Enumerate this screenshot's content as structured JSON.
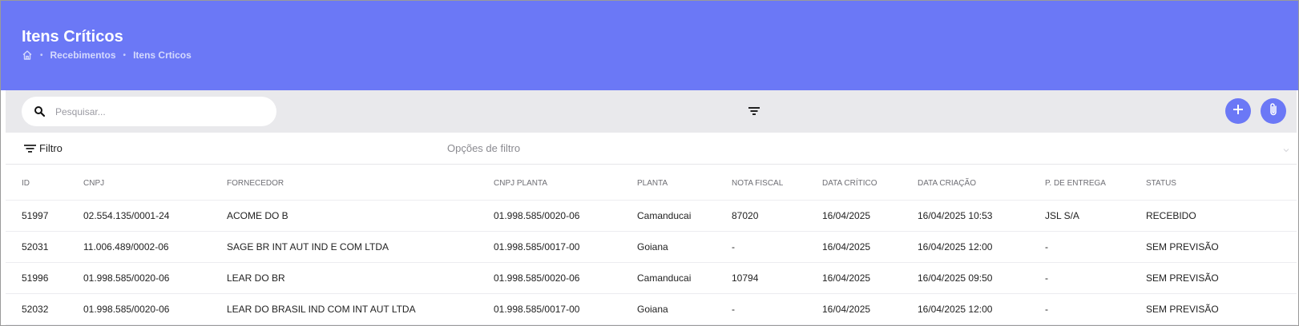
{
  "header": {
    "title": "Itens Críticos",
    "breadcrumb": {
      "home_icon": "home-icon",
      "items": [
        "Recebimentos",
        "Itens Crticos"
      ]
    },
    "background": "#6b78f6"
  },
  "toolbar": {
    "search_placeholder": "Pesquisar...",
    "search_value": "",
    "search_icon": "search-icon",
    "filter_icon": "filter-icon",
    "add_icon": "plus-icon",
    "attach_icon": "paperclip-icon"
  },
  "filterbar": {
    "filter_label": "Filtro",
    "options_label": "Opções de filtro"
  },
  "table": {
    "columns": [
      "ID",
      "CNPJ",
      "FORNECEDOR",
      "CNPJ PLANTA",
      "PLANTA",
      "NOTA FISCAL",
      "DATA CRÍTICO",
      "DATA CRIAÇÃO",
      "P. DE ENTREGA",
      "STATUS"
    ],
    "rows": [
      [
        "51997",
        "02.554.135/0001-24",
        "ACOME DO B",
        "01.998.585/0020-06",
        "Camanducai",
        "87020",
        "16/04/2025",
        "16/04/2025 10:53",
        "JSL S/A",
        "RECEBIDO"
      ],
      [
        "52031",
        "11.006.489/0002-06",
        "SAGE BR INT AUT IND E COM LTDA",
        "01.998.585/0017-00",
        "Goiana",
        "-",
        "16/04/2025",
        "16/04/2025 12:00",
        "-",
        "SEM PREVISÃO"
      ],
      [
        "51996",
        "01.998.585/0020-06",
        "LEAR DO BR",
        "01.998.585/0020-06",
        "Camanducai",
        "10794",
        "16/04/2025",
        "16/04/2025 09:50",
        "-",
        "SEM PREVISÃO"
      ],
      [
        "52032",
        "01.998.585/0020-06",
        "LEAR DO BRASIL IND COM INT AUT LTDA",
        "01.998.585/0017-00",
        "Goiana",
        "-",
        "16/04/2025",
        "16/04/2025 12:00",
        "-",
        "SEM PREVISÃO"
      ]
    ]
  }
}
